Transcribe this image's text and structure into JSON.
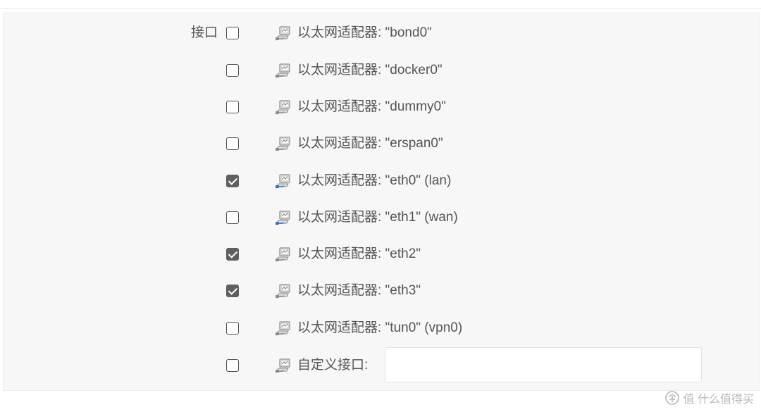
{
  "field_label": "接口",
  "interfaces": [
    {
      "label": "以太网适配器: \"bond0\"",
      "checked": false,
      "active": false
    },
    {
      "label": "以太网适配器: \"docker0\"",
      "checked": false,
      "active": false
    },
    {
      "label": "以太网适配器: \"dummy0\"",
      "checked": false,
      "active": false
    },
    {
      "label": "以太网适配器: \"erspan0\"",
      "checked": false,
      "active": false
    },
    {
      "label": "以太网适配器: \"eth0\" (lan)",
      "checked": true,
      "active": true
    },
    {
      "label": "以太网适配器: \"eth1\" (wan)",
      "checked": false,
      "active": true
    },
    {
      "label": "以太网适配器: \"eth2\"",
      "checked": true,
      "active": false
    },
    {
      "label": "以太网适配器: \"eth3\"",
      "checked": true,
      "active": false
    },
    {
      "label": "以太网适配器: \"tun0\" (vpn0)",
      "checked": false,
      "active": false
    }
  ],
  "custom": {
    "label": "自定义接口:",
    "checked": false,
    "value": "",
    "placeholder": ""
  },
  "watermark": {
    "text": "值 什么值得买",
    "logo": "smzdm-logo"
  },
  "colors": {
    "panel_bg": "#f7f7f7",
    "checkbox_checked": "#5f5f5f",
    "text": "#555555"
  }
}
